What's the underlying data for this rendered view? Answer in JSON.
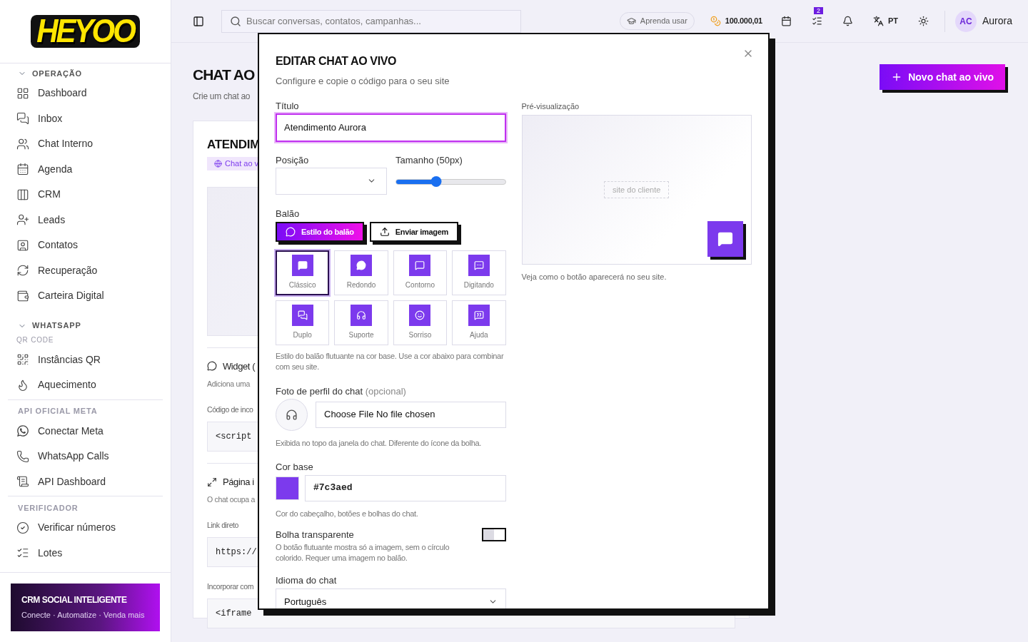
{
  "sidebar": {
    "logo": "HEYOO",
    "sections": [
      {
        "title": "OPERAÇÃO",
        "expanded": true,
        "items": [
          "Dashboard",
          "Inbox",
          "Chat Interno",
          "Agenda",
          "CRM",
          "Leads",
          "Contatos",
          "Recuperação",
          "Carteira Digital"
        ]
      },
      {
        "title": "WHATSAPP",
        "expanded": true,
        "subtitle": "QR CODE",
        "items": [
          "Instâncias QR",
          "Aquecimento"
        ]
      },
      {
        "title": "API OFICIAL META",
        "items": [
          "Conectar Meta",
          "WhatsApp Calls",
          "API Dashboard"
        ]
      },
      {
        "title": "VERIFICADOR",
        "items": [
          "Verificar números",
          "Lotes"
        ]
      }
    ],
    "promo": {
      "title": "CRM SOCIAL INTELIGENTE",
      "text": "Conecte · Automatize · Venda mais"
    }
  },
  "header": {
    "search_placeholder": "Buscar conversas, contatos, campanhas...",
    "learn_button": "Aprenda usar",
    "credits": "100.000,01",
    "tasks_badge": "2",
    "language": "PT",
    "avatar": "AC",
    "user": "Aurora"
  },
  "page": {
    "title": "CHAT AO",
    "subtitle": "Crie um chat ao",
    "new_button": "Novo chat ao vivo",
    "card": {
      "title": "ATENDIM",
      "badge": "Chat ao v",
      "sections": [
        {
          "title": "Widget (",
          "description": "Adiciona uma",
          "fields": [
            {
              "label": "Código de inco",
              "code": "<script"
            }
          ]
        },
        {
          "title": "Página i",
          "description": "O chat ocupa a",
          "fields": [
            {
              "label": "Link direto",
              "code": "https://"
            },
            {
              "label": "Incorporar com",
              "code": "<iframe"
            }
          ]
        }
      ]
    }
  },
  "modal": {
    "title": "EDITAR CHAT AO VIVO",
    "subtitle": "Configure e copie o código para o seu site",
    "title_field": {
      "label": "Título",
      "value": "Atendimento Aurora"
    },
    "position": {
      "label": "Posição"
    },
    "size": {
      "label": "Tamanho (50px)",
      "level": 0.37
    },
    "balloon": {
      "label": "Balão",
      "tabs": [
        {
          "label": "Estilo do balão",
          "selected": true
        },
        {
          "label": "Enviar imagem",
          "selected": false
        }
      ],
      "styles": [
        {
          "label": "Clássico",
          "selected": true
        },
        {
          "label": "Redondo",
          "selected": false
        },
        {
          "label": "Contorno",
          "selected": false
        },
        {
          "label": "Digitando",
          "selected": false
        },
        {
          "label": "Duplo",
          "selected": false
        },
        {
          "label": "Suporte",
          "selected": false
        },
        {
          "label": "Sorriso",
          "selected": false
        },
        {
          "label": "Ajuda",
          "selected": false
        }
      ],
      "hint": "Estilo do balão flutuante na cor base. Use a cor abaixo para combinar com seu site."
    },
    "photo": {
      "label": "Foto de perfil do chat",
      "label_note": "(opcional)",
      "file_text": "Choose File No file chosen",
      "hint": "Exibida no topo da janela do chat. Diferente do ícone da bolha."
    },
    "base_color": {
      "label": "Cor base",
      "value": "#7c3aed",
      "hint": "Cor do cabeçalho, botões e bolhas do chat."
    },
    "transparent": {
      "label": "Bolha transparente",
      "on": false,
      "hint": "O botão flutuante mostra só a imagem, sem o círculo colorido. Requer uma imagem no balão."
    },
    "language": {
      "label": "Idioma do chat",
      "value": "Português"
    },
    "preview": {
      "label": "Pré-visualização",
      "placeholder_text": "site do cliente",
      "caption": "Veja como o botão aparecerá no seu site."
    }
  }
}
